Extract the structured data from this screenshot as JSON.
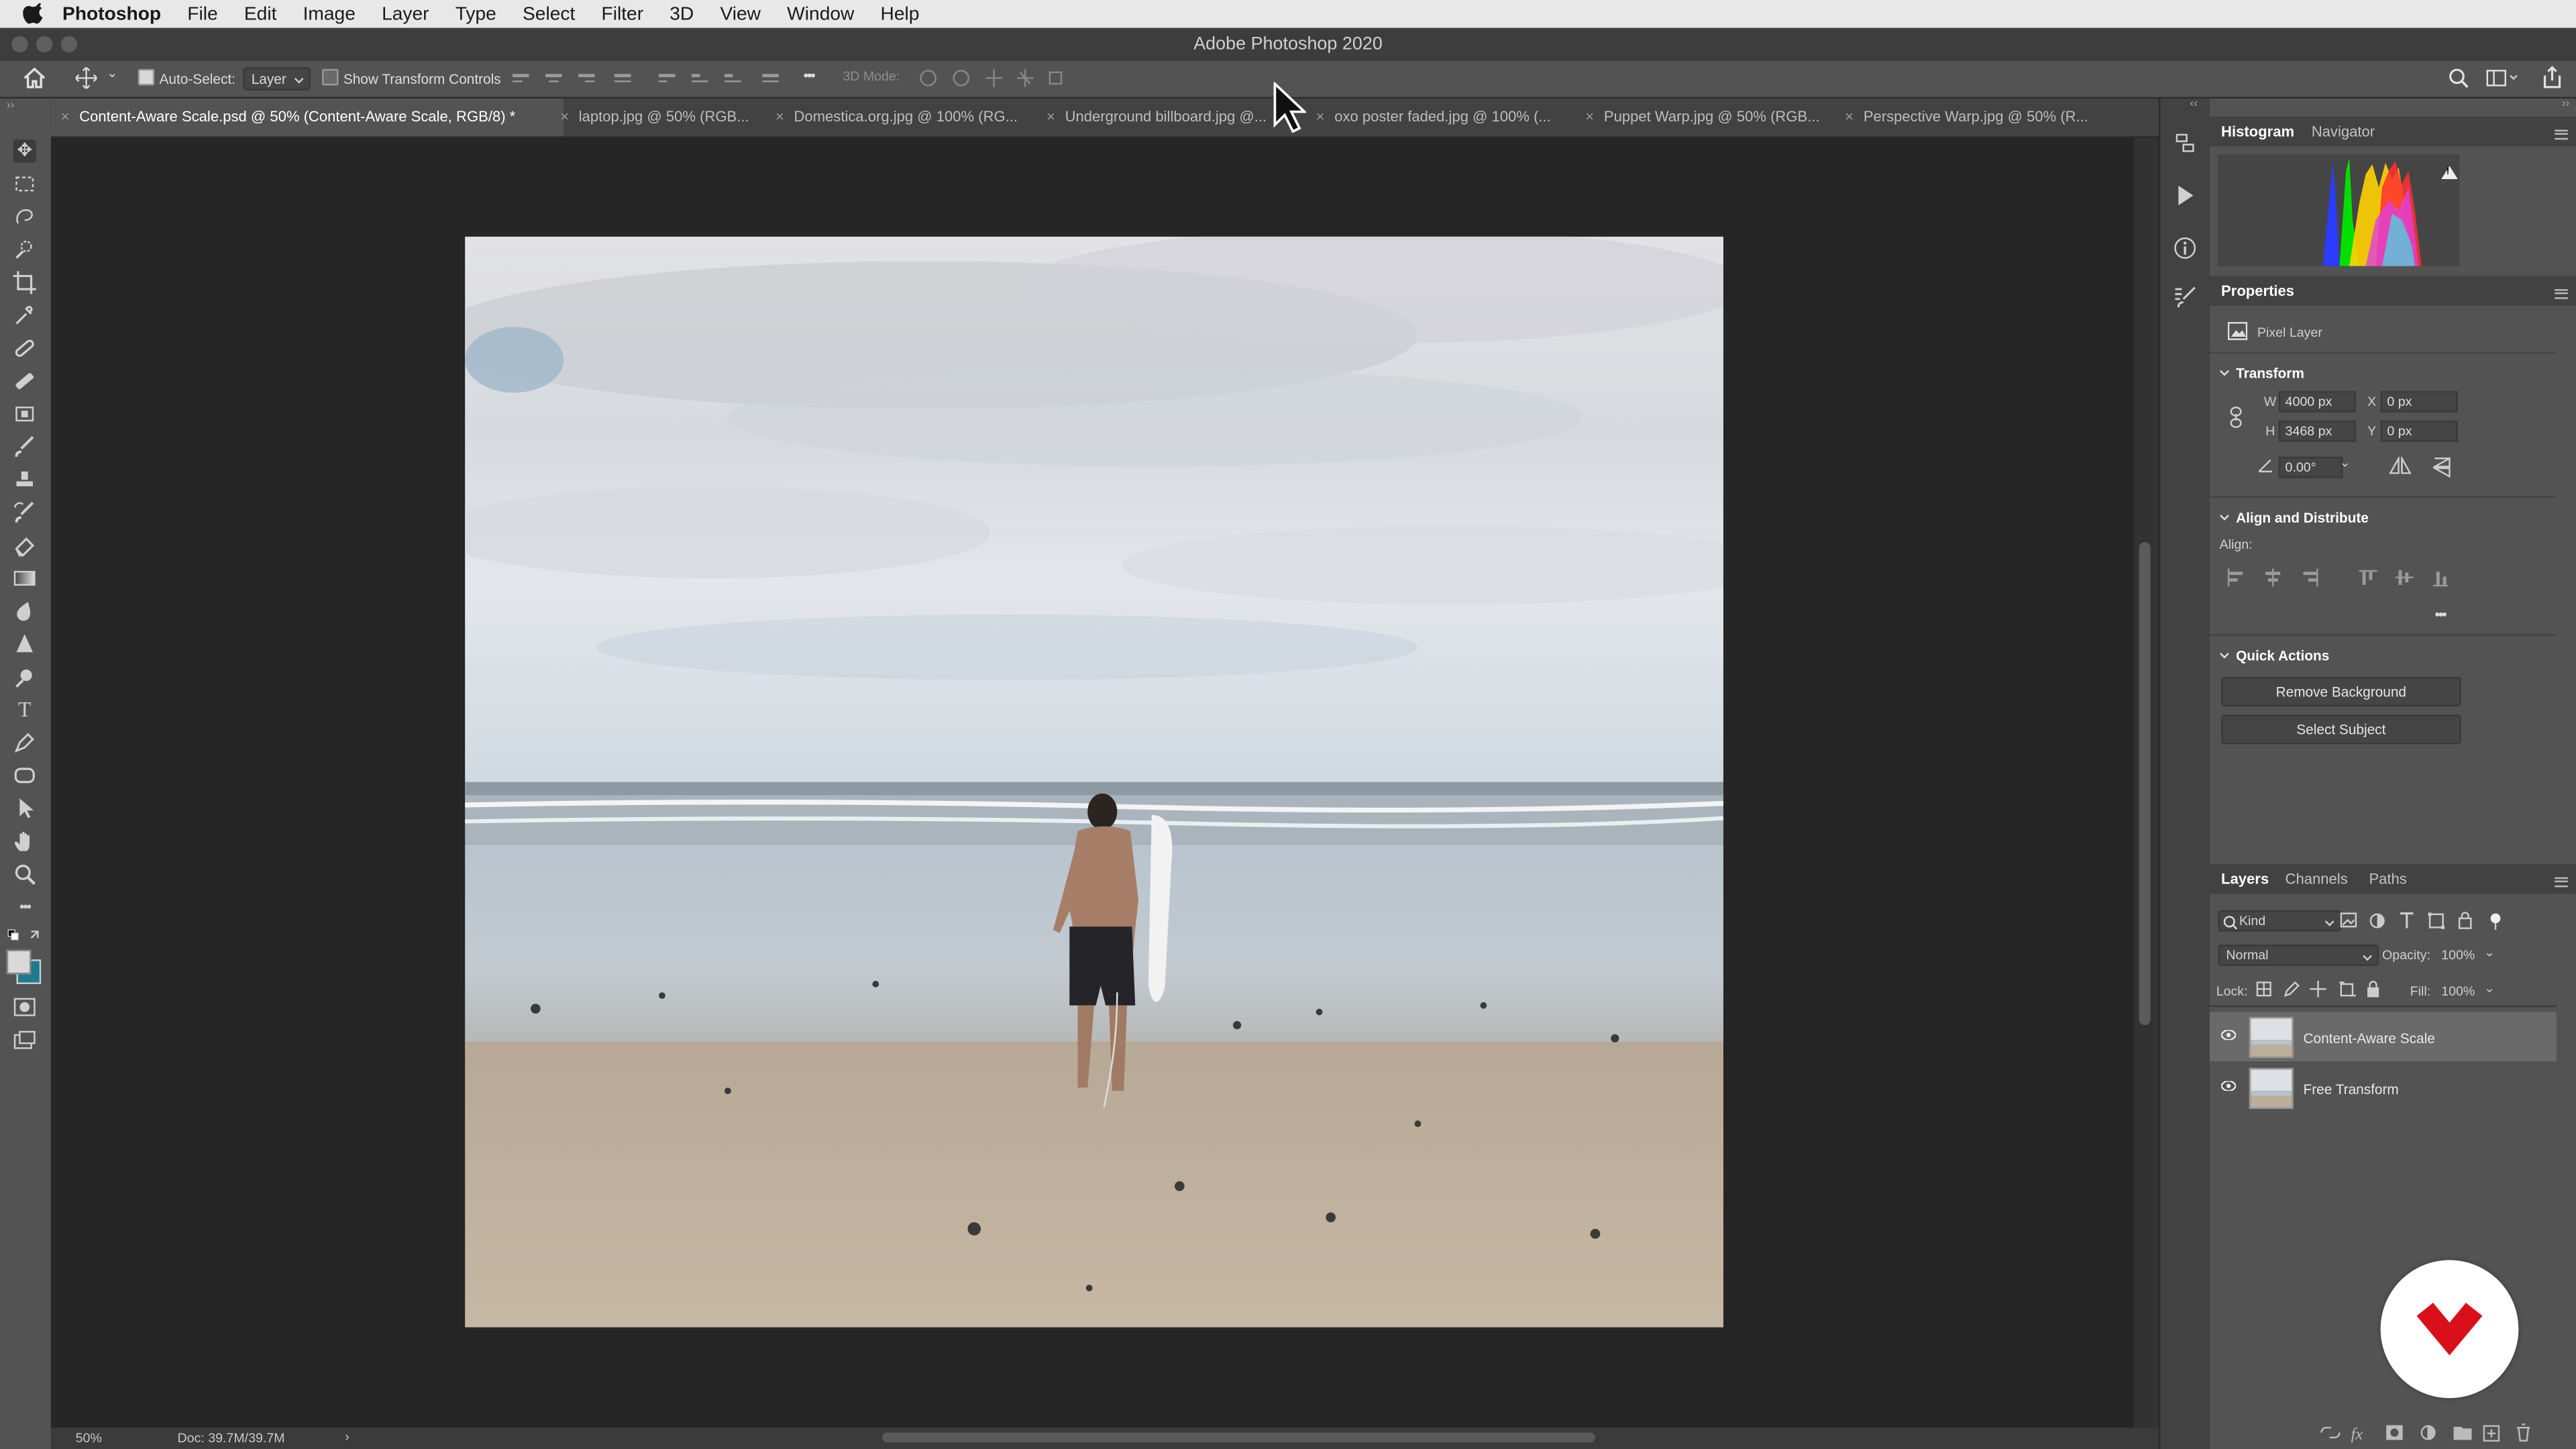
{
  "menubar": {
    "app": "Photoshop",
    "items": [
      "File",
      "Edit",
      "Image",
      "Layer",
      "Type",
      "Select",
      "Filter",
      "3D",
      "View",
      "Window",
      "Help"
    ]
  },
  "window": {
    "title": "Adobe Photoshop 2020"
  },
  "options": {
    "auto_select_label": "Auto-Select:",
    "auto_select_value": "Layer",
    "show_transform_label": "Show Transform Controls",
    "mode_3d_label": "3D Mode:",
    "more": "•••"
  },
  "tabs": [
    {
      "label": "Content-Aware Scale.psd @ 50% (Content-Aware Scale, RGB/8) *"
    },
    {
      "label": "laptop.jpg @ 50% (RGB..."
    },
    {
      "label": "Domestica.org.jpg @ 100% (RG..."
    },
    {
      "label": "Underground billboard.jpg @..."
    },
    {
      "label": "oxo poster faded.jpg @ 100% (..."
    },
    {
      "label": "Puppet Warp.jpg @ 50% (RGB..."
    },
    {
      "label": "Perspective Warp.jpg @ 50% (R..."
    }
  ],
  "status": {
    "zoom": "50%",
    "doc": "Doc: 39.7M/39.7M",
    "arrow": "›"
  },
  "histogram": {
    "tab_histogram": "Histogram",
    "tab_navigator": "Navigator",
    "warning": "!"
  },
  "properties": {
    "title": "Properties",
    "layer_kind": "Pixel Layer",
    "transform_title": "Transform",
    "w_label": "W",
    "w_value": "4000 px",
    "h_label": "H",
    "h_value": "3468 px",
    "x_label": "X",
    "x_value": "0 px",
    "y_label": "Y",
    "y_value": "0 px",
    "angle_value": "0.00°",
    "align_title": "Align and Distribute",
    "align_label": "Align:",
    "more": "•••",
    "quick_title": "Quick Actions",
    "remove_bg": "Remove Background",
    "select_subject": "Select Subject"
  },
  "layers_panel": {
    "tab_layers": "Layers",
    "tab_channels": "Channels",
    "tab_paths": "Paths",
    "kind": "Kind",
    "blend_mode": "Normal",
    "opacity_label": "Opacity:",
    "opacity_value": "100%",
    "lock_label": "Lock:",
    "fill_label": "Fill:",
    "fill_value": "100%",
    "layers": [
      {
        "name": "Content-Aware Scale",
        "selected": true
      },
      {
        "name": "Free Transform",
        "selected": false
      }
    ]
  },
  "colors": {
    "accent_logo": "#d90f1a",
    "foreground": "#d9d9d9",
    "background": "#1e7a8c"
  }
}
